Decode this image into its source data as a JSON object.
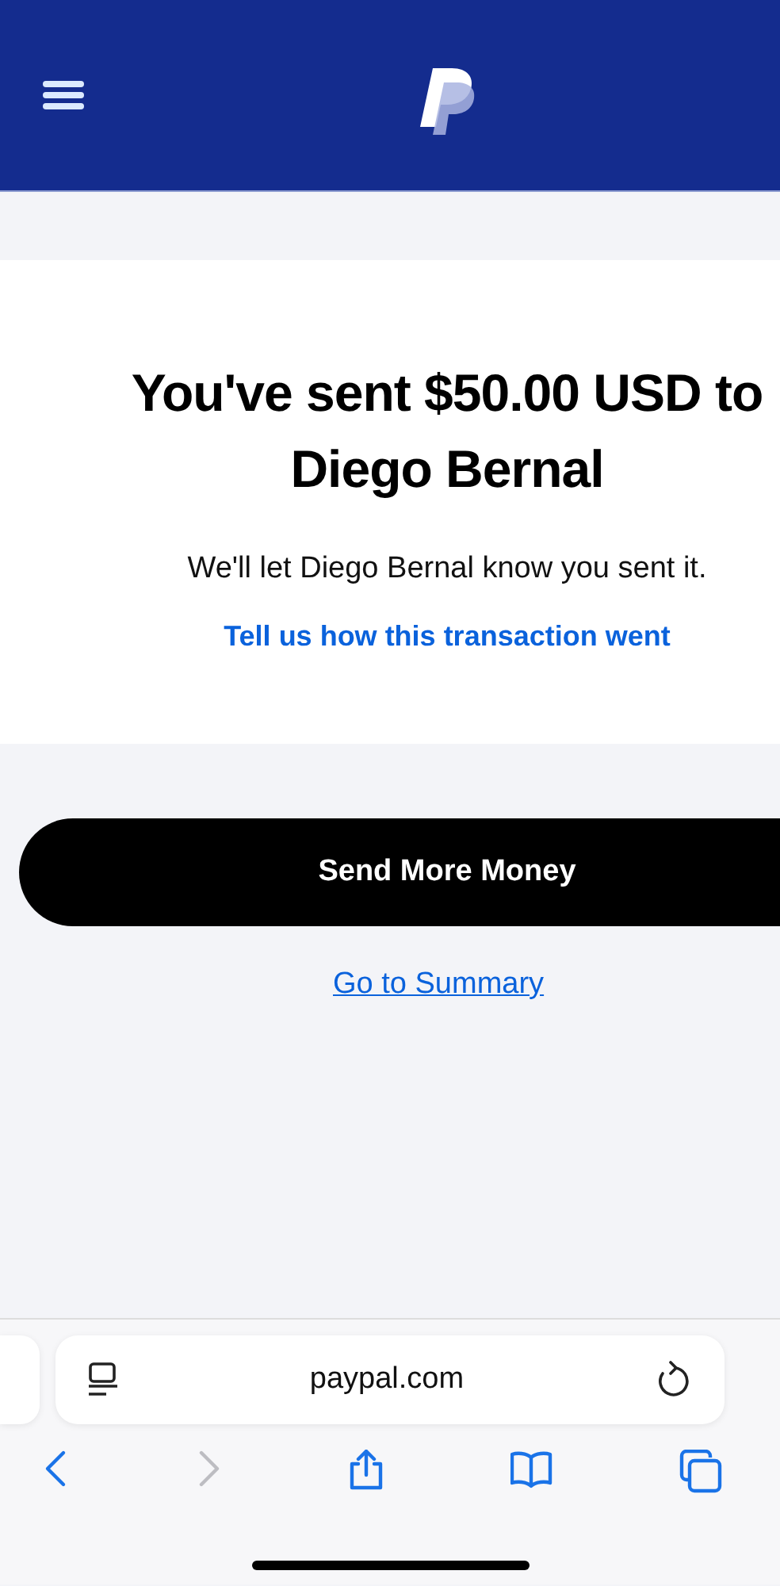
{
  "confirmation": {
    "title": "You've sent $50.00 USD to Diego Bernal",
    "message": "We'll let Diego Bernal know you sent it.",
    "feedback_link": "Tell us how this transaction went"
  },
  "actions": {
    "primary_button": "Send More Money",
    "summary_link": "Go to Summary"
  },
  "browser": {
    "address": "paypal.com",
    "toolbar": [
      {
        "kind": "back",
        "disabled": false
      },
      {
        "kind": "forward",
        "disabled": true
      },
      {
        "kind": "share",
        "disabled": false
      },
      {
        "kind": "bookmarks",
        "disabled": false
      },
      {
        "kind": "tabs",
        "disabled": false
      }
    ]
  }
}
